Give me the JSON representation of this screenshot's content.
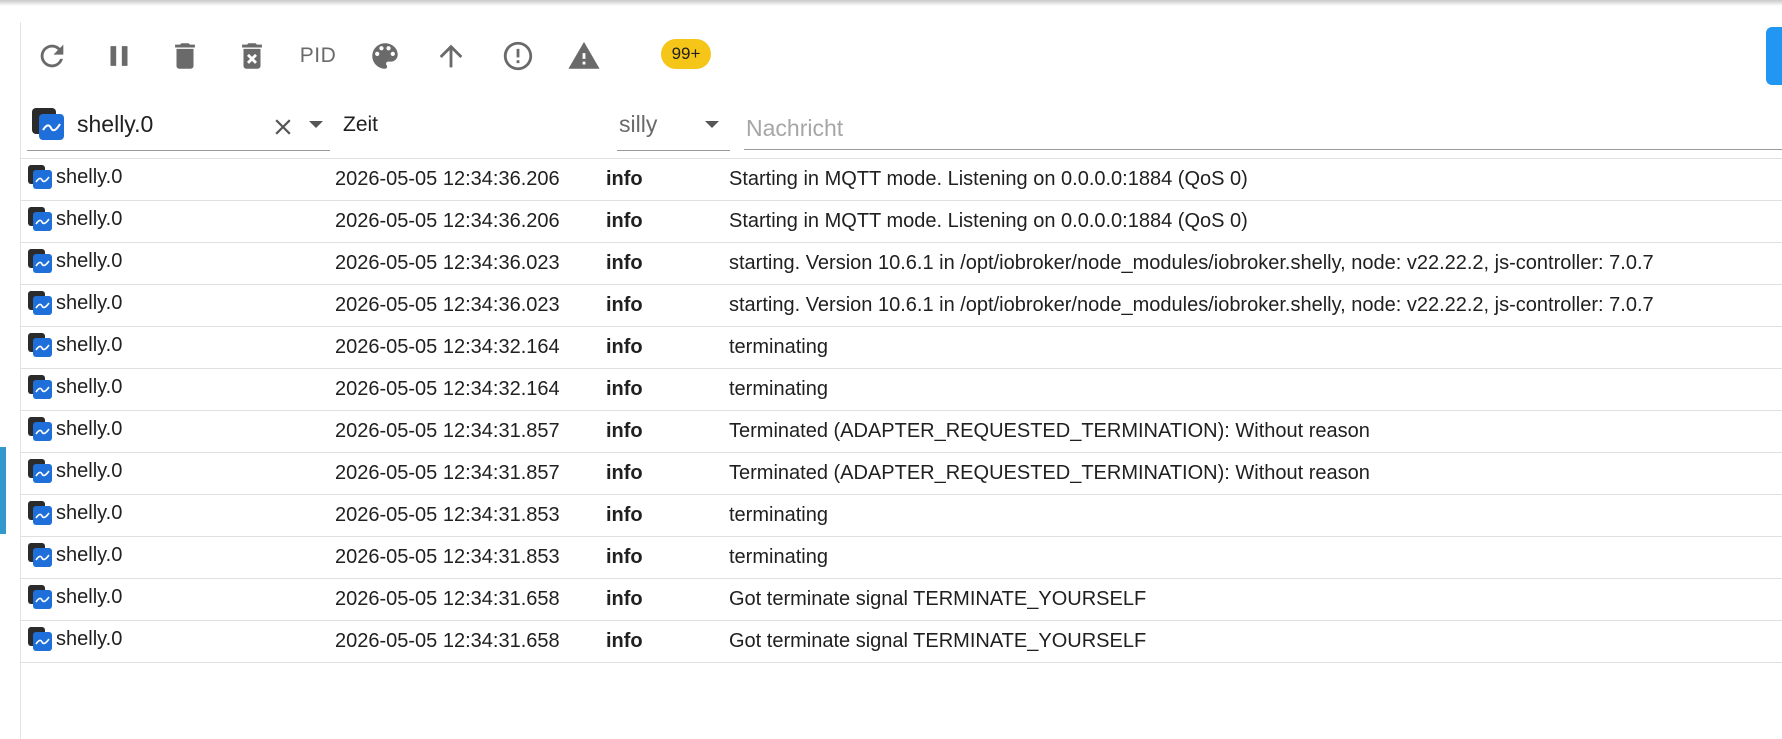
{
  "toolbar": {
    "buttons": [
      {
        "name": "refresh-icon",
        "label": ""
      },
      {
        "name": "pause-icon",
        "label": ""
      },
      {
        "name": "delete-icon",
        "label": ""
      },
      {
        "name": "delete-forever-icon",
        "label": ""
      },
      {
        "name": "pid-toggle",
        "label": "PID"
      },
      {
        "name": "palette-icon",
        "label": ""
      },
      {
        "name": "arrow-up-icon",
        "label": ""
      },
      {
        "name": "error-circle-icon",
        "label": ""
      },
      {
        "name": "warning-icon",
        "label": ""
      }
    ],
    "pid_label": "PID",
    "warnings_badge": "99+",
    "badge_color": "#f5c518"
  },
  "filters": {
    "adapter": "shelly.0",
    "time_header": "Zeit",
    "level": "silly",
    "message_placeholder": "Nachricht"
  },
  "colors": {
    "accent": "#2196f3",
    "adapter_icon": "#1e6fd9",
    "sidebar_accent": "#3399cc"
  },
  "log": {
    "rows": [
      {
        "adapter": "shelly.0",
        "time": "2026-05-05 12:34:36.206",
        "level": "info",
        "message": "Starting in MQTT mode. Listening on 0.0.0.0:1884 (QoS 0)"
      },
      {
        "adapter": "shelly.0",
        "time": "2026-05-05 12:34:36.206",
        "level": "info",
        "message": "Starting in MQTT mode. Listening on 0.0.0.0:1884 (QoS 0)"
      },
      {
        "adapter": "shelly.0",
        "time": "2026-05-05 12:34:36.023",
        "level": "info",
        "message": "starting. Version 10.6.1 in /opt/iobroker/node_modules/iobroker.shelly, node: v22.22.2, js-controller: 7.0.7"
      },
      {
        "adapter": "shelly.0",
        "time": "2026-05-05 12:34:36.023",
        "level": "info",
        "message": "starting. Version 10.6.1 in /opt/iobroker/node_modules/iobroker.shelly, node: v22.22.2, js-controller: 7.0.7"
      },
      {
        "adapter": "shelly.0",
        "time": "2026-05-05 12:34:32.164",
        "level": "info",
        "message": "terminating"
      },
      {
        "adapter": "shelly.0",
        "time": "2026-05-05 12:34:32.164",
        "level": "info",
        "message": "terminating"
      },
      {
        "adapter": "shelly.0",
        "time": "2026-05-05 12:34:31.857",
        "level": "info",
        "message": "Terminated (ADAPTER_REQUESTED_TERMINATION): Without reason"
      },
      {
        "adapter": "shelly.0",
        "time": "2026-05-05 12:34:31.857",
        "level": "info",
        "message": "Terminated (ADAPTER_REQUESTED_TERMINATION): Without reason"
      },
      {
        "adapter": "shelly.0",
        "time": "2026-05-05 12:34:31.853",
        "level": "info",
        "message": "terminating"
      },
      {
        "adapter": "shelly.0",
        "time": "2026-05-05 12:34:31.853",
        "level": "info",
        "message": "terminating"
      },
      {
        "adapter": "shelly.0",
        "time": "2026-05-05 12:34:31.658",
        "level": "info",
        "message": "Got terminate signal TERMINATE_YOURSELF"
      },
      {
        "adapter": "shelly.0",
        "time": "2026-05-05 12:34:31.658",
        "level": "info",
        "message": "Got terminate signal TERMINATE_YOURSELF"
      }
    ]
  }
}
